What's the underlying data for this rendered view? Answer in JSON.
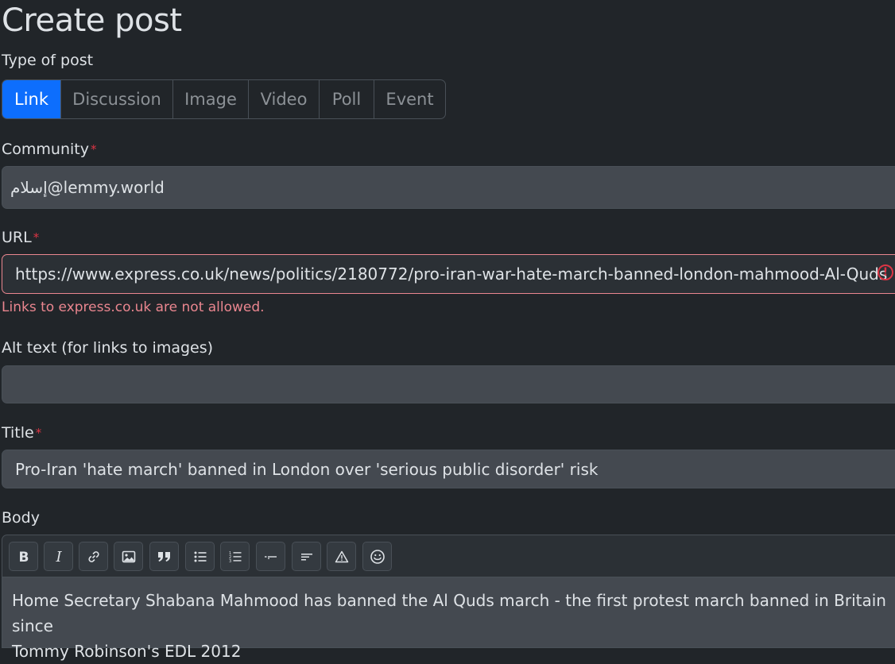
{
  "page": {
    "title": "Create post"
  },
  "post_type": {
    "label": "Type of post",
    "tabs": [
      {
        "label": "Link",
        "active": true
      },
      {
        "label": "Discussion",
        "active": false
      },
      {
        "label": "Image",
        "active": false
      },
      {
        "label": "Video",
        "active": false
      },
      {
        "label": "Poll",
        "active": false
      },
      {
        "label": "Event",
        "active": false
      }
    ]
  },
  "community": {
    "label": "Community",
    "required_mark": "*",
    "value": "إسلام@lemmy.world"
  },
  "url": {
    "label": "URL",
    "required_mark": "*",
    "value": "https://www.express.co.uk/news/politics/2180772/pro-iran-war-hate-march-banned-london-mahmood-Al-Quds",
    "error": "Links to express.co.uk are not allowed.",
    "error_icon": "!"
  },
  "alt_text": {
    "label": "Alt text (for links to images)",
    "value": ""
  },
  "title": {
    "label": "Title",
    "required_mark": "*",
    "value": "Pro-Iran 'hate march' banned in London over 'serious public disorder' risk"
  },
  "body": {
    "label": "Body",
    "toolbar": [
      "bold-icon",
      "italic-icon",
      "link-icon",
      "image-icon",
      "quote-icon",
      "bullet-list-icon",
      "numbered-list-icon",
      "horizontal-rule-icon",
      "subscript-icon",
      "spoiler-warning-icon",
      "emoji-icon"
    ],
    "value": "Home Secretary Shabana Mahmood has banned the Al Quds march - the first protest march banned in Britain since\nTommy Robinson's EDL 2012"
  },
  "colors": {
    "accent": "#0d6efd",
    "required": "#dc3545",
    "error": "#ea868f",
    "background": "#212529"
  }
}
